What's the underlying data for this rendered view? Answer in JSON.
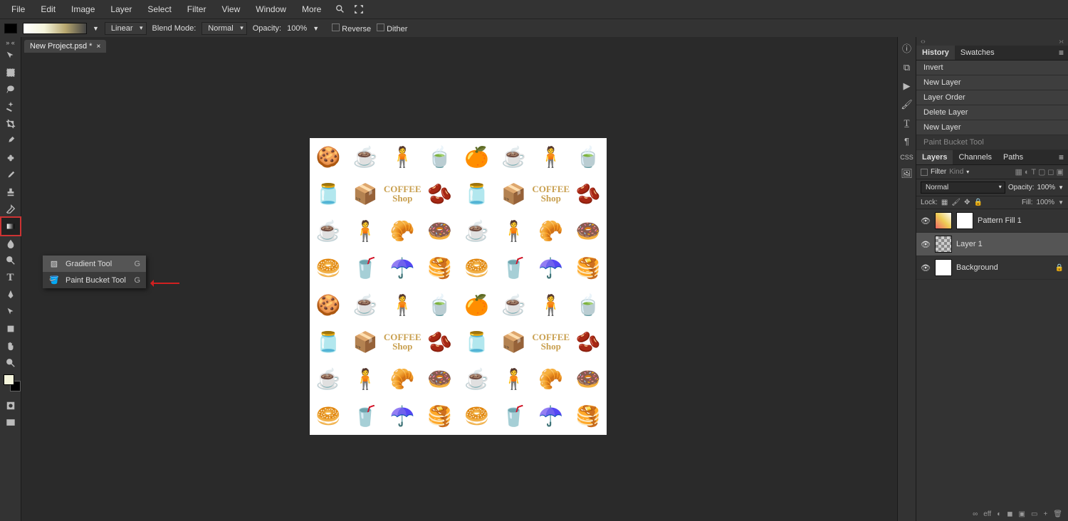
{
  "menu": {
    "items": [
      "File",
      "Edit",
      "Image",
      "Layer",
      "Select",
      "Filter",
      "View",
      "Window",
      "More"
    ]
  },
  "options": {
    "type_label": "Linear",
    "blend_label": "Blend Mode:",
    "blend_value": "Normal",
    "opacity_label": "Opacity:",
    "opacity_value": "100%",
    "reverse": "Reverse",
    "dither": "Dither"
  },
  "document": {
    "tab_title": "New Project.psd *"
  },
  "flyout": {
    "items": [
      {
        "label": "Gradient Tool",
        "shortcut": "G",
        "selected": true
      },
      {
        "label": "Paint Bucket Tool",
        "shortcut": "G",
        "selected": false
      }
    ]
  },
  "canvas": {
    "coffee_shop_text": "COFFEE\nShop"
  },
  "panels": {
    "history_tab": "History",
    "swatches_tab": "Swatches",
    "history": [
      "Invert",
      "New Layer",
      "Layer Order",
      "Delete Layer",
      "New Layer",
      "Paint Bucket Tool"
    ],
    "layers_tabs": [
      "Layers",
      "Channels",
      "Paths"
    ],
    "filter_label": "Filter",
    "filter_kind": "Kind",
    "blend_mode": "Normal",
    "opacity_label": "Opacity:",
    "opacity_value": "100%",
    "lock_label": "Lock:",
    "fill_label": "Fill:",
    "fill_value": "100%",
    "layers": [
      {
        "name": "Pattern Fill 1",
        "locked": false,
        "active": false,
        "thumb": "pat",
        "mask": true
      },
      {
        "name": "Layer 1",
        "locked": false,
        "active": true,
        "thumb": "checker",
        "mask": false
      },
      {
        "name": "Background",
        "locked": true,
        "active": false,
        "thumb": "white",
        "mask": false
      }
    ],
    "footer_icons": [
      "∞",
      "eff",
      "◐",
      "◼",
      "▣",
      "▭",
      "+",
      "🗑"
    ]
  }
}
